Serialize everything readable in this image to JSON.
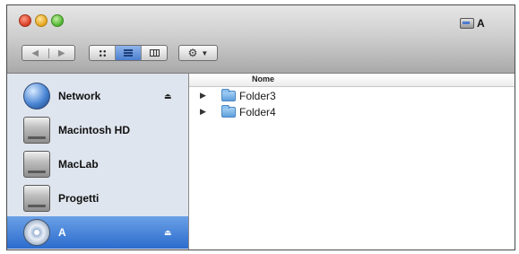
{
  "window": {
    "title": "A"
  },
  "toolbar": {
    "back_icon": "back-arrow-icon",
    "forward_icon": "forward-arrow-icon",
    "view_modes": [
      "icon-view",
      "list-view",
      "column-view"
    ],
    "active_view": "list-view",
    "action_icon": "gear-icon"
  },
  "sidebar": {
    "items": [
      {
        "label": "Network",
        "icon": "network-globe-icon",
        "eject": true,
        "selected": false
      },
      {
        "label": "Macintosh HD",
        "icon": "hard-drive-icon",
        "eject": false,
        "selected": false
      },
      {
        "label": "MacLab",
        "icon": "hard-drive-icon",
        "eject": false,
        "selected": false
      },
      {
        "label": "Progetti",
        "icon": "hard-drive-icon",
        "eject": false,
        "selected": false
      },
      {
        "label": "A",
        "icon": "disc-icon",
        "eject": true,
        "selected": true
      }
    ],
    "eject_glyph": "⏏"
  },
  "content": {
    "column_header": "Nome",
    "rows": [
      {
        "name": "Folder3",
        "icon": "folder-icon"
      },
      {
        "name": "Folder4",
        "icon": "folder-icon"
      }
    ],
    "disclosure_glyph": "▶"
  },
  "colors": {
    "selection": "#2c6ccd",
    "sidebar_bg": "#dfe5ee",
    "folder": "#5d9fdc"
  }
}
